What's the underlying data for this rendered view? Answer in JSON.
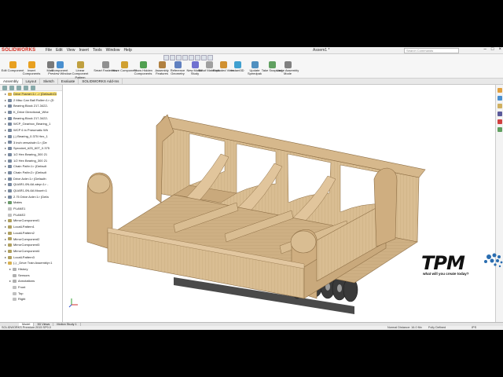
{
  "app": {
    "name": "SOLIDWORKS",
    "document_title": "Assem1 *",
    "search_placeholder": "Search Commands",
    "menu": [
      "File",
      "Edit",
      "View",
      "Insert",
      "Tools",
      "Window",
      "Help"
    ]
  },
  "ribbon": {
    "buttons": [
      {
        "label": "Edit Component",
        "color": "#e8a020"
      },
      {
        "label": "Insert Components",
        "color": "#e8a020"
      },
      {
        "label": "Mate",
        "color": "#7a7a7a"
      },
      {
        "label": "Component Preview Window",
        "color": "#4a90d0"
      },
      {
        "label": "Linear Component Pattern",
        "color": "#c0a040"
      },
      {
        "label": "Smart Fasteners",
        "color": "#909090"
      },
      {
        "label": "Move Component",
        "color": "#d0a030"
      },
      {
        "label": "Show Hidden Components",
        "color": "#50a050"
      },
      {
        "label": "Assembly Features",
        "color": "#b08040"
      },
      {
        "label": "Reference Geometry",
        "color": "#6080c0"
      },
      {
        "label": "New Motion Study",
        "color": "#7070d0"
      },
      {
        "label": "Bill of Materials",
        "color": "#a0a0a0"
      },
      {
        "label": "Exploded View",
        "color": "#d09030"
      },
      {
        "label": "Instant3D",
        "color": "#40a0d0"
      },
      {
        "label": "Update Speedpak",
        "color": "#5090c0"
      },
      {
        "label": "Take Snapshot",
        "color": "#60a060"
      },
      {
        "label": "Large Assembly Mode",
        "color": "#808080"
      }
    ]
  },
  "tabs": [
    "Assembly",
    "Layout",
    "Sketch",
    "Evaluate",
    "SOLIDWORKS Add-Ins"
  ],
  "tree": {
    "items": [
      {
        "label": "Drive Frame<1> -> (Default<Di",
        "color": "#d8b050",
        "toggle": "▸",
        "selected": true
      },
      {
        "label": "2 Misc Can Ball Roller<1> (D",
        "color": "#7a8aa0",
        "toggle": "▸"
      },
      {
        "label": "Bearing Block 217-3422-",
        "color": "#7a8aa0",
        "toggle": "▸"
      },
      {
        "label": "K_Drive Directional_Whe",
        "color": "#7a8aa0",
        "toggle": "▸"
      },
      {
        "label": "Bearing Block 217-3422-",
        "color": "#7a8aa0",
        "toggle": "▸"
      },
      {
        "label": "WCP_Gearbox_Bearing_1",
        "color": "#7a8aa0",
        "toggle": "▸"
      },
      {
        "label": "WCP 6 in Pneumatic Wh",
        "color": "#7a8aa0",
        "toggle": "▸"
      },
      {
        "label": "(-) Bearing_0.375 Hex_1",
        "color": "#7a8aa0",
        "toggle": "▸"
      },
      {
        "label": "3 inch versahub<1> (De",
        "color": "#7a8aa0",
        "toggle": "▸"
      },
      {
        "label": "Sprocket_#25_60T_0.375",
        "color": "#7a8aa0",
        "toggle": "▸"
      },
      {
        "label": "1/2 Hex Bearing_300 21",
        "color": "#7a8aa0",
        "toggle": "▸"
      },
      {
        "label": "1/2 Hex Bearing_300 21",
        "color": "#7a8aa0",
        "toggle": "▸"
      },
      {
        "label": "Chain Path<1> (Default",
        "color": "#7a8aa0",
        "toggle": "▸"
      },
      {
        "label": "Chain Path<2> (Default",
        "color": "#7a8aa0",
        "toggle": "▸"
      },
      {
        "label": "Drive Axle<1> (Default<",
        "color": "#7a8aa0",
        "toggle": "▸"
      },
      {
        "label": "QUAR1-0N-6A.step<1> -",
        "color": "#7a8aa0",
        "toggle": "▸"
      },
      {
        "label": "QUAR1-0N-6A Mount<1",
        "color": "#7a8aa0",
        "toggle": "▸"
      },
      {
        "label": "2.75 Drive Axle<1> (Defa",
        "color": "#7a8aa0",
        "toggle": "▸"
      },
      {
        "label": "Mates",
        "color": "#6a9a6a",
        "toggle": "▸"
      },
      {
        "label": "PLANE1",
        "color": "#c0c0c0",
        "toggle": ""
      },
      {
        "label": "PLANE2",
        "color": "#c0c0c0",
        "toggle": ""
      },
      {
        "label": "MirrorComponent1",
        "color": "#b0a060",
        "toggle": "▸"
      },
      {
        "label": "LocalLPattern1",
        "color": "#b0a060",
        "toggle": "▸"
      },
      {
        "label": "LocalLPattern2",
        "color": "#b0a060",
        "toggle": "▸"
      },
      {
        "label": "MirrorComponent2",
        "color": "#b0a060",
        "toggle": "▸"
      },
      {
        "label": "MirrorComponent3",
        "color": "#b0a060",
        "toggle": "▸"
      },
      {
        "label": "MirrorComponent4",
        "color": "#b0a060",
        "toggle": "▸"
      },
      {
        "label": "LocalLPattern3",
        "color": "#b0a060",
        "toggle": "▸"
      },
      {
        "label": "(-) _Drive Train Assembly<1",
        "color": "#d8b050",
        "toggle": "▾"
      },
      {
        "label": "History",
        "color": "#b0b0b0",
        "toggle": "▸"
      },
      {
        "label": "Sensors",
        "color": "#b0b0b0",
        "toggle": ""
      },
      {
        "label": "Annotations",
        "color": "#b0b0b0",
        "toggle": "▸"
      },
      {
        "label": "Front",
        "color": "#c0c0c0",
        "toggle": ""
      },
      {
        "label": "Top",
        "color": "#c0c0c0",
        "toggle": ""
      },
      {
        "label": "Right",
        "color": "#c0c0c0",
        "toggle": ""
      }
    ]
  },
  "bottom_tabs": [
    "Model",
    "3D Views",
    "Motion Study 1"
  ],
  "status": {
    "product": "SOLIDWORKS Premium 2015 SP0.0",
    "distance": "Normal Distance: 16.0 ftin",
    "definition": "Fully Defined",
    "units": "IPS"
  },
  "watermark": {
    "logo": "TPM",
    "tagline": "what will you create today?"
  },
  "colors": {
    "wood": "#d9bd92",
    "wood_dark": "#b8976a",
    "wood_shadow": "#c9a97c",
    "rail_blue": "#5b8fd8",
    "metal": "#5a5a5a",
    "wheel": "#3a3a3a"
  }
}
